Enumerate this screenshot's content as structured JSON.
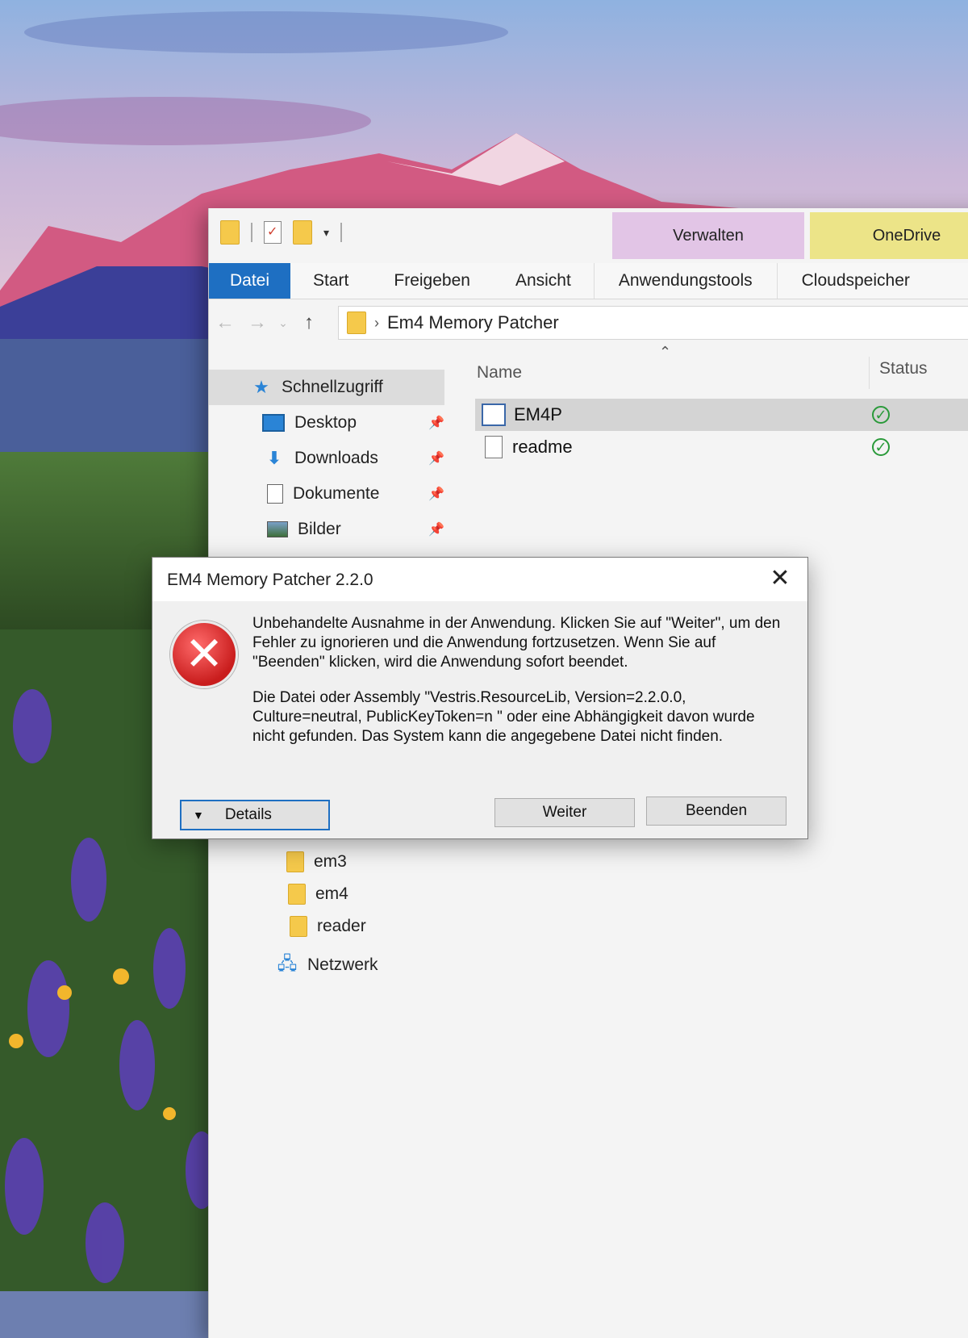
{
  "explorer": {
    "context_tabs": {
      "manage": "Verwalten",
      "onedrive": "OneDrive"
    },
    "ribbon_tabs": [
      "Datei",
      "Start",
      "Freigeben",
      "Ansicht",
      "Anwendungstools",
      "Cloudspeicher"
    ],
    "address": {
      "path": "Em4 Memory Patcher"
    },
    "nav": {
      "quick_access": "Schnellzugriff",
      "items": [
        "Desktop",
        "Downloads",
        "Dokumente",
        "Bilder"
      ],
      "folders": [
        "em3",
        "em4",
        "reader"
      ],
      "network": "Netzwerk"
    },
    "columns": {
      "name": "Name",
      "status": "Status"
    },
    "files": [
      {
        "name": "EM4P",
        "status": "synced"
      },
      {
        "name": "readme",
        "status": "synced"
      }
    ]
  },
  "dialog": {
    "title": "EM4 Memory Patcher 2.2.0",
    "message1": "Unbehandelte Ausnahme in der Anwendung. Klicken Sie auf \"Weiter\", um den Fehler zu ignorieren und die Anwendung fortzusetzen. Wenn Sie auf \"Beenden\" klicken, wird die Anwendung sofort beendet.",
    "message2": "Die Datei oder Assembly \"Vestris.ResourceLib, Version=2.2.0.0, Culture=neutral, PublicKeyToken=n  \" oder eine Abhängigkeit davon wurde nicht gefunden. Das System kann die angegebene Datei nicht finden.",
    "buttons": {
      "details": "Details",
      "continue": "Weiter",
      "quit": "Beenden"
    }
  },
  "colors": {
    "accent": "#1e6fc2",
    "manage_tab": "#e2c5e6",
    "onedrive_tab": "#ece488",
    "error": "#c91d1d"
  }
}
